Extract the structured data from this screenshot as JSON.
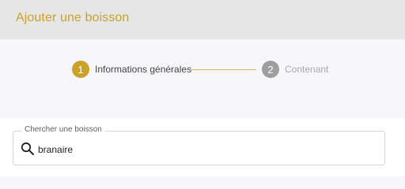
{
  "header": {
    "title": "Ajouter une boisson"
  },
  "stepper": {
    "steps": [
      {
        "number": "1",
        "label": "Informations générales",
        "state": "active"
      },
      {
        "number": "2",
        "label": "Contenant",
        "state": "inactive"
      }
    ]
  },
  "search": {
    "legend": "Chercher une boisson",
    "value": "branaire",
    "icon": "search-icon"
  },
  "colors": {
    "accent": "#c9a227",
    "inactive": "#9e9e9e",
    "header_bg": "#e6e6e6",
    "page_bg": "#f7f7fb"
  }
}
